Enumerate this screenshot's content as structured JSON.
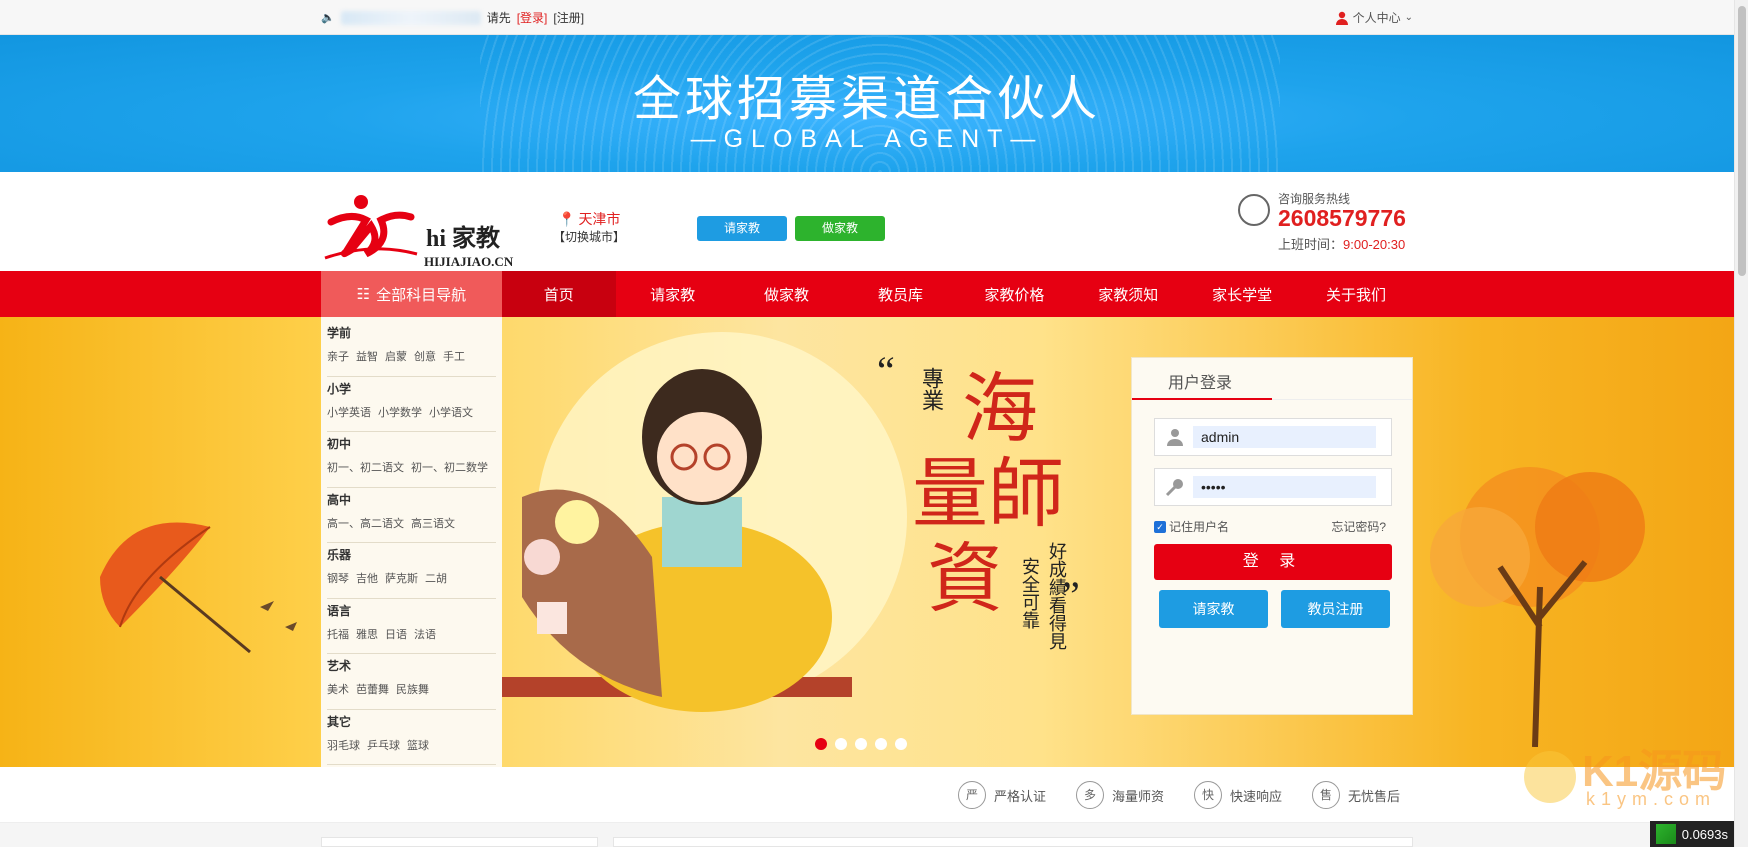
{
  "topbar": {
    "prefix": "请先",
    "login_link": "[登录]",
    "register_link": "[注册]",
    "user_center": "个人中心"
  },
  "banner": {
    "title": "全球招募渠道合伙人",
    "subtitle": "—GLOBAL AGENT—"
  },
  "header": {
    "logo_name": "hi 家教",
    "logo_domain": "HIJIAJIAO.CN",
    "city": "天津市",
    "switch_city": "【切换城市】",
    "btn_request": "请家教",
    "btn_become": "做家教",
    "hotline_label": "咨询服务热线",
    "hotline_number": "2608579776",
    "hours_label": "上班时间：",
    "hours_value": "9:00-20:30"
  },
  "nav": {
    "category_label": "全部科目导航",
    "items": [
      "首页",
      "请家教",
      "做家教",
      "教员库",
      "家教价格",
      "家教须知",
      "家长学堂",
      "关于我们"
    ]
  },
  "sidebar": {
    "categories": [
      {
        "title": "学前",
        "items": [
          "亲子",
          "益智",
          "启蒙",
          "创意",
          "手工"
        ]
      },
      {
        "title": "小学",
        "items": [
          "小学英语",
          "小学数学",
          "小学语文"
        ]
      },
      {
        "title": "初中",
        "items": [
          "初一、初二语文",
          "初一、初二数学"
        ]
      },
      {
        "title": "高中",
        "items": [
          "高一、高二语文",
          "高三语文"
        ]
      },
      {
        "title": "乐器",
        "items": [
          "钢琴",
          "吉他",
          "萨克斯",
          "二胡"
        ]
      },
      {
        "title": "语言",
        "items": [
          "托福",
          "雅思",
          "日语",
          "法语"
        ]
      },
      {
        "title": "艺术",
        "items": [
          "美术",
          "芭蕾舞",
          "民族舞"
        ]
      },
      {
        "title": "其它",
        "items": [
          "羽毛球",
          "乒乓球",
          "篮球"
        ]
      }
    ]
  },
  "hero": {
    "quote_open": "“",
    "quote_close": "”",
    "tag": "專業",
    "big1": "海",
    "big2": "量師",
    "big3": "資",
    "side1": "安全可靠",
    "side2": "好成績看得見",
    "active_slide": 1,
    "slide_count": 5
  },
  "login": {
    "tab": "用户登录",
    "username": "admin",
    "password": "•••••",
    "remember": "记住用户名",
    "forgot": "忘记密码?",
    "submit": "登 录",
    "btn_request": "请家教",
    "btn_register": "教员注册"
  },
  "features": [
    {
      "icon": "严",
      "label": "严格认证"
    },
    {
      "icon": "多",
      "label": "海量师资"
    },
    {
      "icon": "快",
      "label": "快速响应"
    },
    {
      "icon": "售",
      "label": "无忧售后"
    }
  ],
  "perf": "0.0693s",
  "watermark": {
    "title": "K1源码",
    "url": "k1ym.com"
  }
}
